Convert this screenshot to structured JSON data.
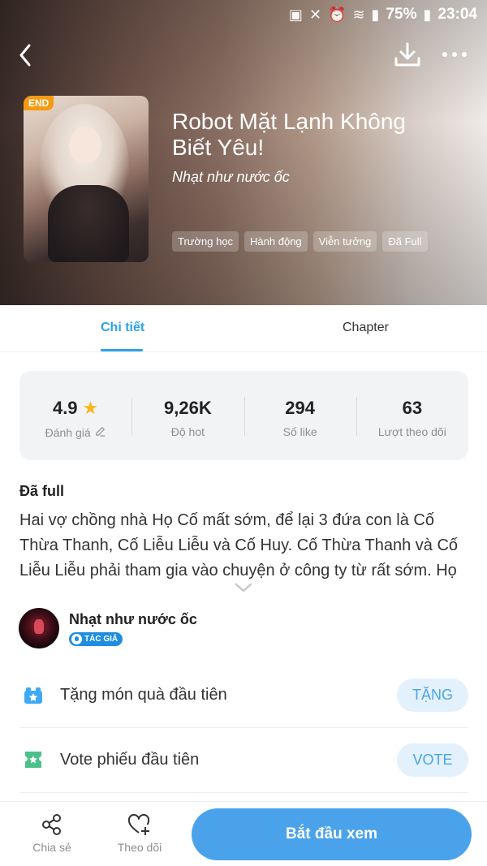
{
  "status_bar": {
    "battery_percent": "75%",
    "time": "23:04"
  },
  "book": {
    "badge": "END",
    "title": "Robot Mặt Lạnh Không Biết Yêu!",
    "author": "Nhạt như nước ốc",
    "tags": [
      "Trường học",
      "Hành động",
      "Viễn tưởng",
      "Đã Full"
    ]
  },
  "tabs": [
    {
      "label": "Chi tiết",
      "active": true
    },
    {
      "label": "Chapter",
      "active": false
    }
  ],
  "stats": [
    {
      "value": "4.9",
      "label": "Đánh giá"
    },
    {
      "value": "9,26K",
      "label": "Độ hot"
    },
    {
      "value": "294",
      "label": "Số like"
    },
    {
      "value": "63",
      "label": "Lượt theo dõi"
    }
  ],
  "description": {
    "status": "Đã full",
    "text": "Hai vợ chồng nhà Họ Cố mất sớm, để lại 3 đứa con là Cố Thừa Thanh, Cố Liễu Liễu và Cố Huy. Cố Thừa Thanh và Cố Liễu Liễu phải tham gia vào chuyện ở công ty từ rất sớm. Họ"
  },
  "author_block": {
    "name": "Nhạt như nước ốc",
    "badge": "TÁC GIẢ"
  },
  "actions": [
    {
      "text": "Tặng món quà đầu tiên",
      "button": "TẶNG",
      "icon": "gift-icon"
    },
    {
      "text": "Vote phiếu đầu tiên",
      "button": "VOTE",
      "icon": "ticket-icon"
    }
  ],
  "bottom_bar": {
    "share": "Chia sẻ",
    "follow": "Theo dõi",
    "start": "Bắt đầu xem"
  },
  "colors": {
    "accent": "#2aa3e8",
    "start_button": "#4aa3ea",
    "badge_end": "#f59b12",
    "star": "#f7b81a",
    "action_icon": "#3fa9f5",
    "vote_icon": "#4cc08a"
  }
}
